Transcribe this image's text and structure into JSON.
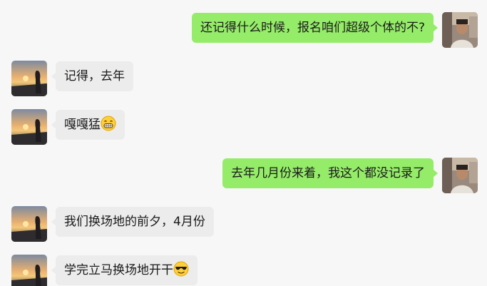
{
  "messages": [
    {
      "side": "right",
      "text": "还记得什么时候，报名咱们超级个体的不?",
      "emoji": null
    },
    {
      "side": "left",
      "text": "记得，去年",
      "emoji": null
    },
    {
      "side": "left",
      "text": "嘎嘎猛",
      "emoji": "grin-emoji"
    },
    {
      "side": "right",
      "text": "去年几月份来着，我这个都没记录了",
      "emoji": null
    },
    {
      "side": "left",
      "text": "我们换场地的前夕，4月份",
      "emoji": null
    },
    {
      "side": "left",
      "text": "学完立马换场地开干",
      "emoji": "sunglasses-emoji"
    }
  ],
  "colors": {
    "sent_bubble": "#95ec69",
    "received_bubble": "#ececec",
    "background": "#f7f7f7"
  }
}
